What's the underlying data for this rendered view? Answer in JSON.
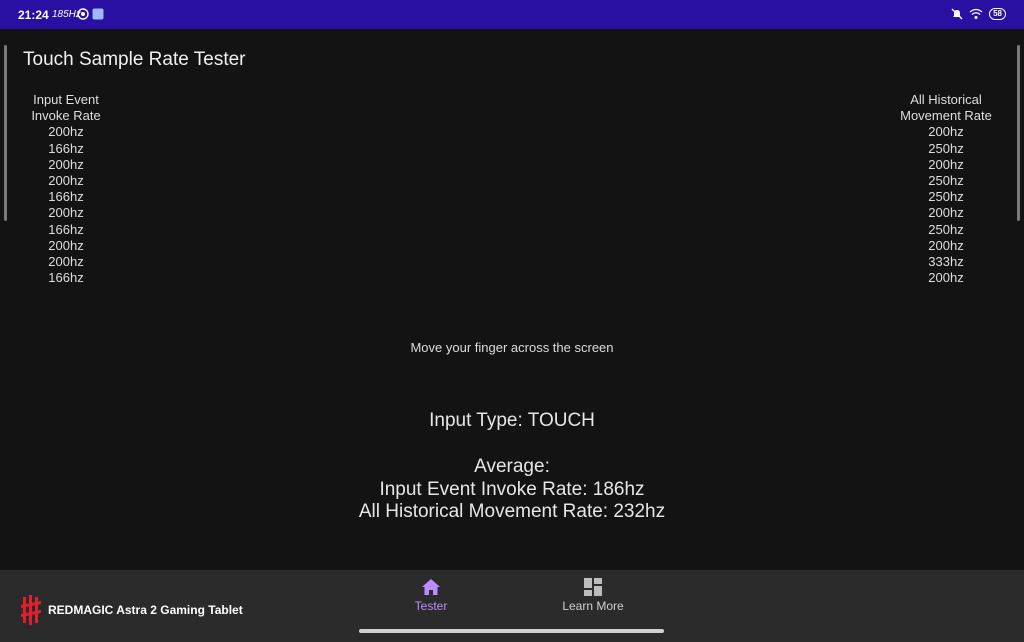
{
  "status": {
    "time": "21:24",
    "refresh": "185Hz",
    "battery": "58"
  },
  "app": {
    "title": "Touch Sample Rate Tester"
  },
  "columns": {
    "left": {
      "header_line1": "Input Event",
      "header_line2": "Invoke Rate",
      "values": [
        "200hz",
        "166hz",
        "200hz",
        "200hz",
        "166hz",
        "200hz",
        "166hz",
        "200hz",
        "200hz",
        "166hz"
      ]
    },
    "right": {
      "header_line1": "All Historical",
      "header_line2": "Movement Rate",
      "values": [
        "200hz",
        "250hz",
        "200hz",
        "250hz",
        "250hz",
        "200hz",
        "250hz",
        "200hz",
        "333hz",
        "200hz"
      ]
    }
  },
  "hint": "Move your finger across the screen",
  "summary": {
    "input_type": "Input Type: TOUCH",
    "average": "Average:",
    "invoke": "Input Event Invoke Rate: 186hz",
    "movement": "All Historical Movement Rate: 232hz"
  },
  "nav": {
    "brand": "REDMAGIC Astra 2 Gaming Tablet",
    "tester": "Tester",
    "learn_more": "Learn More"
  },
  "colors": {
    "status_bar": "#2a0fa3",
    "accent": "#b98cff",
    "brand_red": "#e0202e"
  }
}
